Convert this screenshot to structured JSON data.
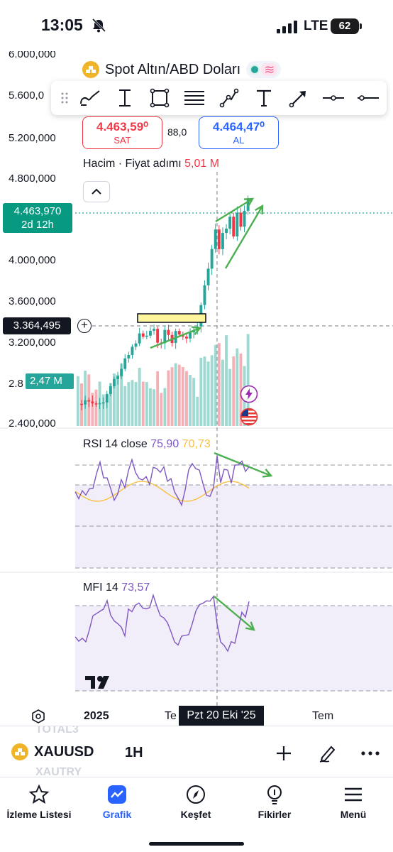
{
  "status_bar": {
    "time": "13:05",
    "network": "LTE",
    "battery": "62"
  },
  "symbol": {
    "title": "Spot Altın/ABD Doları",
    "icon": "gold-bars-icon"
  },
  "quotes": {
    "sell_price": "4.463,59⁰",
    "sell_label": "SAT",
    "spread": "88,0",
    "buy_price": "4.464,47⁰",
    "buy_label": "AL"
  },
  "volume_legend": {
    "label": "Hacim · Fiyat adımı",
    "value": "5,01 M"
  },
  "price_axis": {
    "labels": [
      "6.000,000",
      "5.600,0",
      "5.200,000",
      "4.800,000",
      "4.000,000",
      "3.600,000",
      "3.200,000",
      "2.8",
      "2.400,000"
    ],
    "last_price": "4.463,970",
    "countdown": "2d 12h",
    "crosshair_price": "3.364,495",
    "volume_tag": "2,47 M"
  },
  "rsi": {
    "label": "RSI 14 close",
    "value": "75,90",
    "ma_value": "70,73"
  },
  "mfi": {
    "label": "MFI 14",
    "value": "73,57"
  },
  "time_axis": {
    "year": "2025",
    "partial": "Te",
    "cursor": "Pzt 20 Eki '25",
    "month": "Tem"
  },
  "bottom_toolbar": {
    "ghost_top": "TOTAL3",
    "ghost_bottom": "XAUTRY",
    "symbol": "XAUUSD",
    "interval": "1H"
  },
  "tabs": [
    {
      "label": "İzleme Listesi",
      "icon": "star-icon"
    },
    {
      "label": "Grafik",
      "icon": "chart-icon"
    },
    {
      "label": "Keşfet",
      "icon": "compass-icon"
    },
    {
      "label": "Fikirler",
      "icon": "lightbulb-icon"
    },
    {
      "label": "Menü",
      "icon": "menu-icon"
    }
  ],
  "colors": {
    "up": "#26a69a",
    "down": "#f23645",
    "accent": "#2962ff",
    "rsi": "#7e57c2",
    "rsi_ma": "#f5c242",
    "annotation": "#4caf50"
  }
}
